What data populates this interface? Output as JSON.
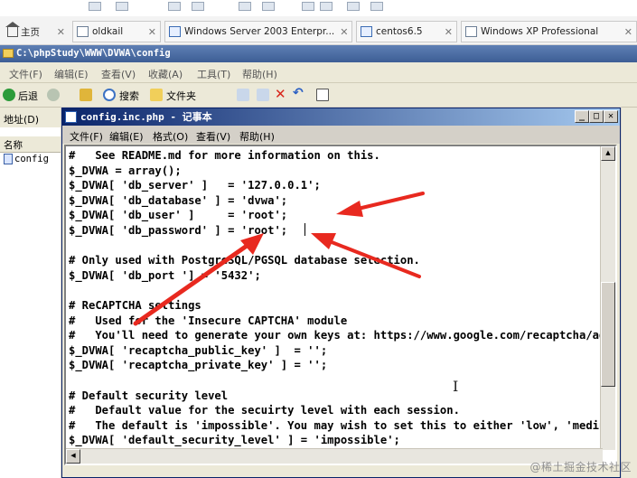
{
  "vm_tabs": {
    "home": "主页",
    "items": [
      {
        "label": "oldkail"
      },
      {
        "label": "Windows Server 2003 Enterpr..."
      },
      {
        "label": "centos6.5"
      },
      {
        "label": "Windows XP Professional"
      }
    ]
  },
  "explorer": {
    "title": "C:\\phpStudy\\WWW\\DVWA\\config",
    "menu": [
      "文件(F)",
      "编辑(E)",
      "查看(V)",
      "收藏(A)",
      "工具(T)",
      "帮助(H)"
    ],
    "toolbar": {
      "back": "后退",
      "search": "搜索",
      "folders": "文件夹"
    },
    "address_label": "地址(D)",
    "column_name": "名称",
    "file_name": "config"
  },
  "notepad": {
    "title": "config.inc.php - 记事本",
    "menu": [
      "文件(F)",
      "编辑(E)",
      "格式(O)",
      "查看(V)",
      "帮助(H)"
    ],
    "code_lines": [
      "#   See README.md for more information on this.",
      "$_DVWA = array();",
      "$_DVWA[ 'db_server' ]   = '127.0.0.1';",
      "$_DVWA[ 'db_database' ] = 'dvwa';",
      "$_DVWA[ 'db_user' ]     = 'root';",
      "$_DVWA[ 'db_password' ] = 'root';",
      "",
      "# Only used with PostgreSQL/PGSQL database selection.",
      "$_DVWA[ 'db_port '] = '5432';",
      "",
      "# ReCAPTCHA settings",
      "#   Used for the 'Insecure CAPTCHA' module",
      "#   You'll need to generate your own keys at: https://www.google.com/recaptcha/admin",
      "$_DVWA[ 'recaptcha_public_key' ]  = '';",
      "$_DVWA[ 'recaptcha_private_key' ] = '';",
      "",
      "# Default security level",
      "#   Default value for the secuirty level with each session.",
      "#   The default is 'impossible'. You may wish to set this to either 'low', 'medium', 'high' or impossible'.",
      "$_DVWA[ 'default_security_level' ] = 'impossible';"
    ]
  },
  "watermark": "@稀土掘金技术社区",
  "colors": {
    "arrow": "#e8291f",
    "notepad_title": "#0a246a",
    "explorer_title": "#4a6ba3"
  }
}
